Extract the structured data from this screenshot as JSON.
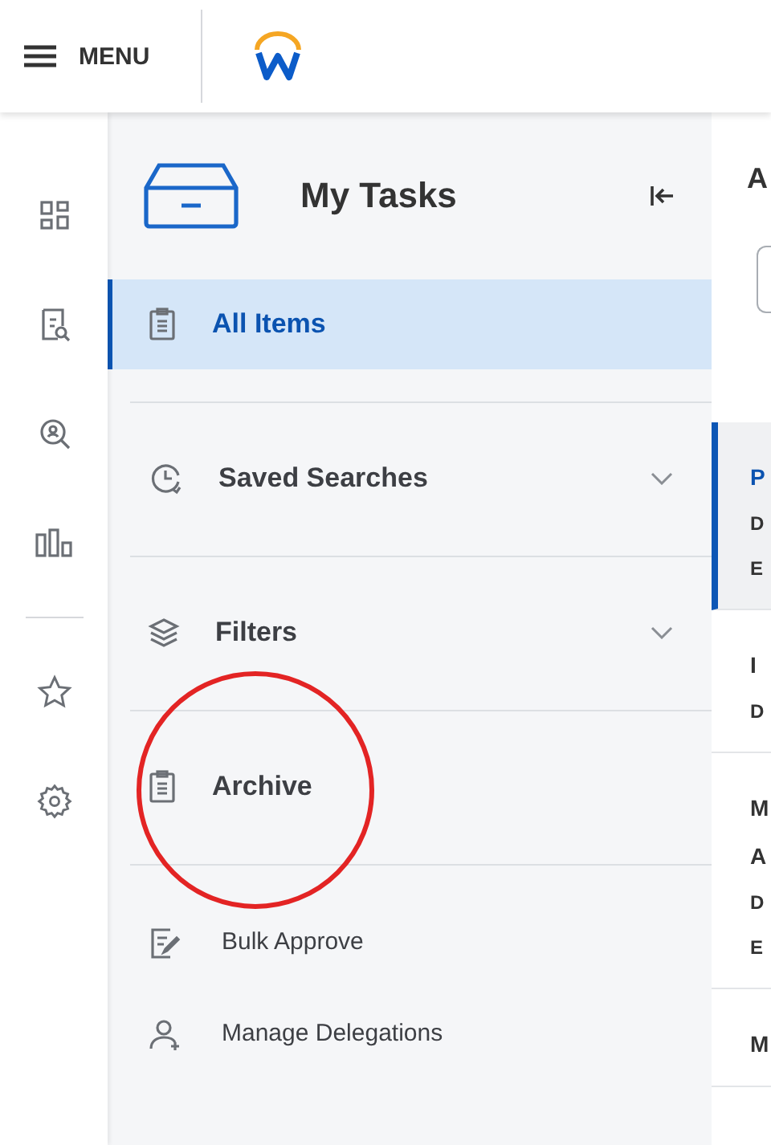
{
  "top_bar": {
    "menu_label": "MENU"
  },
  "tasks_panel": {
    "title": "My Tasks",
    "items": [
      {
        "label": "All Items",
        "selected": true,
        "kind": "main"
      },
      {
        "label": "Saved Searches",
        "selected": false,
        "kind": "expandable",
        "expanded": false
      },
      {
        "label": "Filters",
        "selected": false,
        "kind": "expandable",
        "expanded": false
      },
      {
        "label": "Archive",
        "selected": false,
        "kind": "main",
        "highlighted": true
      },
      {
        "label": "Bulk Approve",
        "selected": false,
        "kind": "action"
      },
      {
        "label": "Manage Delegations",
        "selected": false,
        "kind": "action"
      }
    ]
  },
  "content": {
    "title": "A",
    "cards": [
      {
        "selected": true,
        "lines": [
          {
            "text": "P",
            "kind": "title"
          },
          {
            "text": "D",
            "kind": "meta"
          },
          {
            "text": "E",
            "kind": "meta"
          }
        ]
      },
      {
        "selected": false,
        "lines": [
          {
            "text": "I",
            "kind": "title"
          },
          {
            "text": "D",
            "kind": "meta"
          }
        ]
      },
      {
        "selected": false,
        "lines": [
          {
            "text": "M",
            "kind": "title"
          },
          {
            "text": "A",
            "kind": "title"
          },
          {
            "text": "D",
            "kind": "meta"
          },
          {
            "text": "E",
            "kind": "meta"
          }
        ]
      },
      {
        "selected": false,
        "lines": [
          {
            "text": "M",
            "kind": "title"
          }
        ]
      }
    ]
  }
}
